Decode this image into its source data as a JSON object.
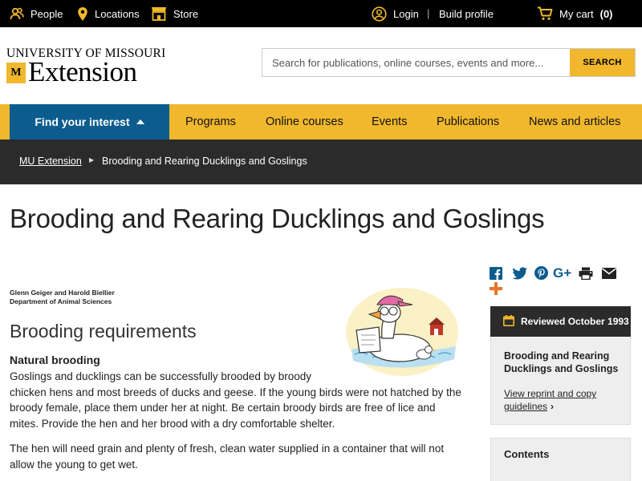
{
  "topbar": {
    "people": "People",
    "locations": "Locations",
    "store": "Store",
    "login": "Login",
    "separator": "|",
    "build_profile": "Build profile",
    "cart": "My cart",
    "cart_count": "(0)",
    "icons": [
      "people-icon",
      "location-pin-icon",
      "store-icon",
      "user-circle-icon",
      "cart-icon"
    ]
  },
  "header": {
    "logo_line1": "UNIVERSITY OF MISSOURI",
    "logo_mark": "M",
    "logo_line2": "Extension",
    "search_placeholder": "Search for publications, online courses, events and more...",
    "search_button": "SEARCH"
  },
  "nav": {
    "find_interest": "Find your interest",
    "items": [
      "Programs",
      "Online courses",
      "Events",
      "Publications",
      "News and articles"
    ]
  },
  "breadcrumb": {
    "items": [
      "MU Extension",
      "Brooding and Rearing Ducklings and Goslings"
    ]
  },
  "article": {
    "title": "Brooding and Rearing Ducklings and Goslings",
    "authors_line1": "Glenn Geiger and Harold Biellier",
    "authors_line2": "Department of Animal Sciences",
    "section_heading": "Brooding requirements",
    "subheading": "Natural brooding",
    "p1_line1": "Goslings and ducklings can be successfully brooded by broody",
    "p1_rest": "chicken hens and most breeds of ducks and geese. If the young birds were not hatched by the broody female, place them under her at night. Be certain broody birds are free of lice and mites. Provide the hen and her brood with a dry comfortable shelter.",
    "p2": "The hen will need grain and plenty of fresh, clean water supplied in a container that will not allow the young to get wet."
  },
  "share": {
    "icons": [
      "facebook-icon",
      "twitter-icon",
      "pinterest-icon",
      "google-plus-icon",
      "print-icon",
      "email-icon",
      "more-share-icon"
    ]
  },
  "sidebar": {
    "reviewed": "Reviewed October 1993",
    "card_title": "Brooding and Rearing Ducklings and Goslings",
    "reprint_link": "View reprint and copy guidelines",
    "contents": "Contents"
  },
  "colors": {
    "gold": "#f1b82d",
    "blue": "#0c5d8e",
    "dark": "#2b2b2b",
    "black": "#000000"
  }
}
